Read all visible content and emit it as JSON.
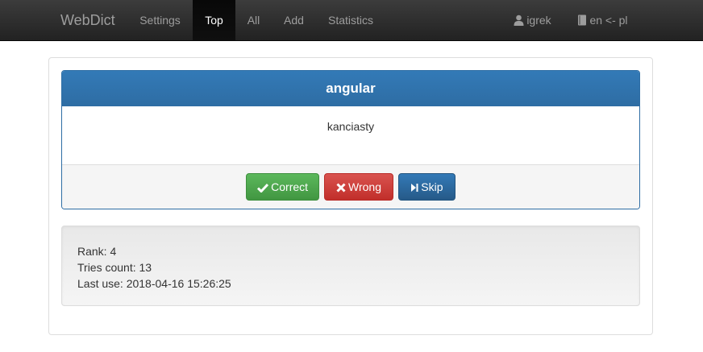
{
  "navbar": {
    "brand": "WebDict",
    "items": [
      {
        "label": "Settings"
      },
      {
        "label": "Top",
        "active": true
      },
      {
        "label": "All"
      },
      {
        "label": "Add"
      },
      {
        "label": "Statistics"
      }
    ],
    "user": {
      "label": "igrek",
      "icon": "user-icon"
    },
    "language": {
      "label": "en <- pl",
      "icon": "book-icon"
    }
  },
  "card": {
    "word": "angular",
    "translation": "kanciasty",
    "buttons": {
      "correct": {
        "label": "Correct",
        "icon": "check-icon",
        "color": "#5cb85c"
      },
      "wrong": {
        "label": "Wrong",
        "icon": "remove-icon",
        "color": "#d9534f"
      },
      "skip": {
        "label": "Skip",
        "icon": "step-forward-icon",
        "color": "#337ab7"
      }
    }
  },
  "stats": {
    "rank": "Rank: 4",
    "tries": "Tries count: 13",
    "last_use": "Last use: 2018-04-16 15:26:25"
  },
  "colors": {
    "accent": "#337ab7",
    "navbar_bg": "#222222"
  }
}
